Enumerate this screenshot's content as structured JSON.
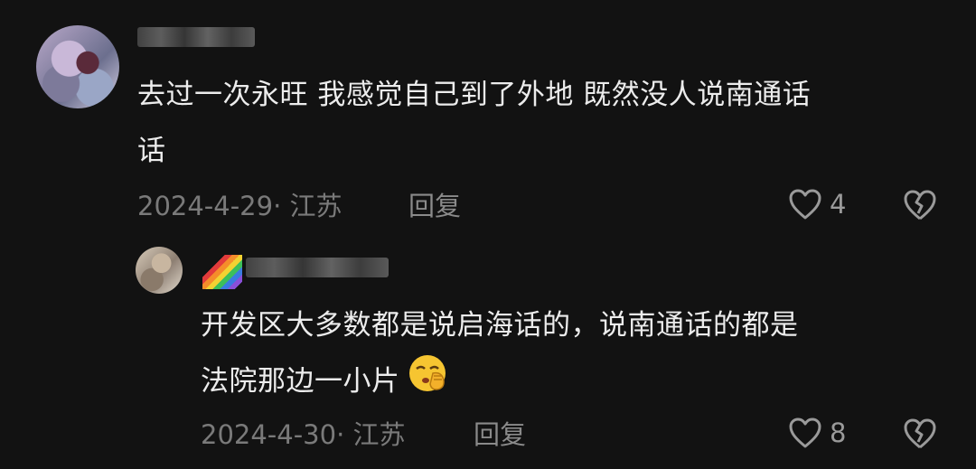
{
  "comments": [
    {
      "text": "去过一次永旺 我感觉自己到了外地 既然没人说南通话",
      "text_wrap": "话",
      "date": "2024-4-29",
      "location": "江苏",
      "reply_label": "回复",
      "likes": "4"
    },
    {
      "text": "开发区大多数都是说启海话的，说南通话的都是",
      "text_wrap": "法院那边一小片",
      "date": "2024-4-30",
      "location": "江苏",
      "reply_label": "回复",
      "likes": "8"
    }
  ],
  "icons": {
    "like": "heart-outline-icon",
    "dislike": "broken-heart-icon",
    "emoji": "shushing-face-emoji"
  },
  "colors": {
    "background": "#121212",
    "text": "#ececec",
    "meta": "#7a7a7a"
  }
}
